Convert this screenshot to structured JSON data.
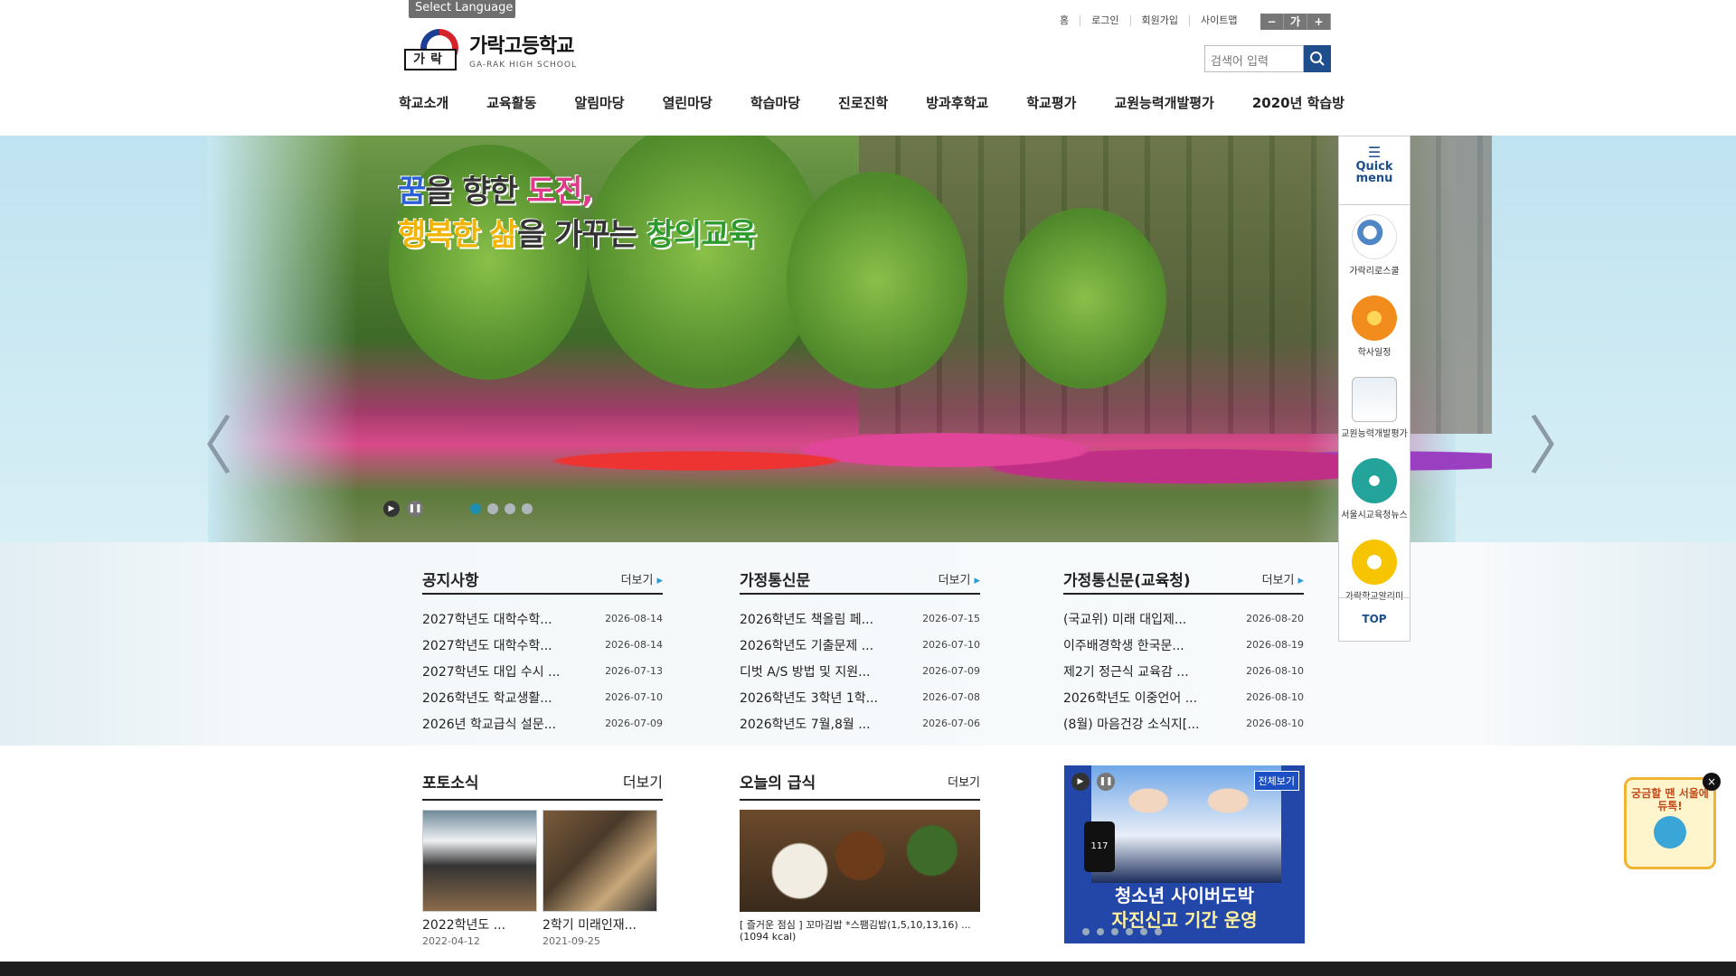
{
  "header": {
    "select_language": "Select Language",
    "logo_title": "가락고등학교",
    "logo_sub": "GA-RAK HIGH SCHOOL",
    "logo_mark_text": "가락",
    "util_links": [
      "홈",
      "로그인",
      "회원가입",
      "사이트맵"
    ],
    "font_controls": [
      "−",
      "가",
      "+"
    ],
    "search_placeholder": "검색어 입력"
  },
  "nav": [
    "학교소개",
    "교육활동",
    "알림마당",
    "열린마당",
    "학습마당",
    "진로진학",
    "방과후학교",
    "학교평가",
    "교원능력개발평가",
    "2020년 학습방"
  ],
  "hero": {
    "slogan_l1_a": "꿈",
    "slogan_l1_b": "을 향한 ",
    "slogan_l1_c": "도전,",
    "slogan_l2_a": "행복한 삶",
    "slogan_l2_b": "을 가꾸는 ",
    "slogan_l2_c": "창의교육",
    "play": "▶",
    "pause": "❚❚",
    "prev": "〈",
    "next": "〉"
  },
  "boards": [
    {
      "title": "공지사항",
      "more": "더보기",
      "items": [
        {
          "title": "2027학년도 대학수학...",
          "date": "2026-08-14"
        },
        {
          "title": "2027학년도 대학수학...",
          "date": "2026-08-14"
        },
        {
          "title": "2027학년도 대입 수시 ...",
          "date": "2026-07-13"
        },
        {
          "title": "2026학년도 학교생활...",
          "date": "2026-07-10"
        },
        {
          "title": "2026년 학교급식 설문...",
          "date": "2026-07-09"
        }
      ]
    },
    {
      "title": "가정통신문",
      "more": "더보기",
      "items": [
        {
          "title": "2026학년도 책올림 페...",
          "date": "2026-07-15"
        },
        {
          "title": "2026학년도 기출문제 ...",
          "date": "2026-07-10"
        },
        {
          "title": "디벗 A/S 방법 및 지원...",
          "date": "2026-07-09"
        },
        {
          "title": "2026학년도 3학년 1학...",
          "date": "2026-07-08"
        },
        {
          "title": "2026학년도 7월,8월 ...",
          "date": "2026-07-06"
        }
      ]
    },
    {
      "title": "가정통신문(교육청)",
      "more": "더보기",
      "items": [
        {
          "title": "(국교위) 미래 대입제...",
          "date": "2026-08-20"
        },
        {
          "title": "이주배경학생 한국문...",
          "date": "2026-08-19"
        },
        {
          "title": "제2기 정근식 교육감 ...",
          "date": "2026-08-10"
        },
        {
          "title": "2026학년도 이중언어 ...",
          "date": "2026-08-10"
        },
        {
          "title": "(8월) 마음건강 소식지[...",
          "date": "2026-08-10"
        }
      ]
    }
  ],
  "photo_news": {
    "title": "포토소식",
    "more": "더보기",
    "items": [
      {
        "caption": "2022학년도 ...",
        "date": "2022-04-12"
      },
      {
        "caption": "2학기 미래인재...",
        "date": "2021-09-25"
      }
    ]
  },
  "meal": {
    "title": "오늘의 급식",
    "more": "더보기",
    "text": "[ 즐거운 점심 ] 꼬마김밥 *스팸김밥(1,5,10,13,16) ... (1094 kcal)"
  },
  "banner": {
    "full": "전체보기",
    "title": "청소년 사이버도박",
    "subtitle": "자진신고 기간 운영",
    "phone": "117"
  },
  "quick": {
    "label": "Quick menu",
    "items": [
      "가락리로스쿨",
      "학사일정",
      "교원능력개발평가",
      "서울시교육청뉴스",
      "가락학교알리미"
    ],
    "top": "TOP"
  },
  "chat": {
    "text": "궁금할 땐 서울에듀톡!",
    "close": "×"
  }
}
